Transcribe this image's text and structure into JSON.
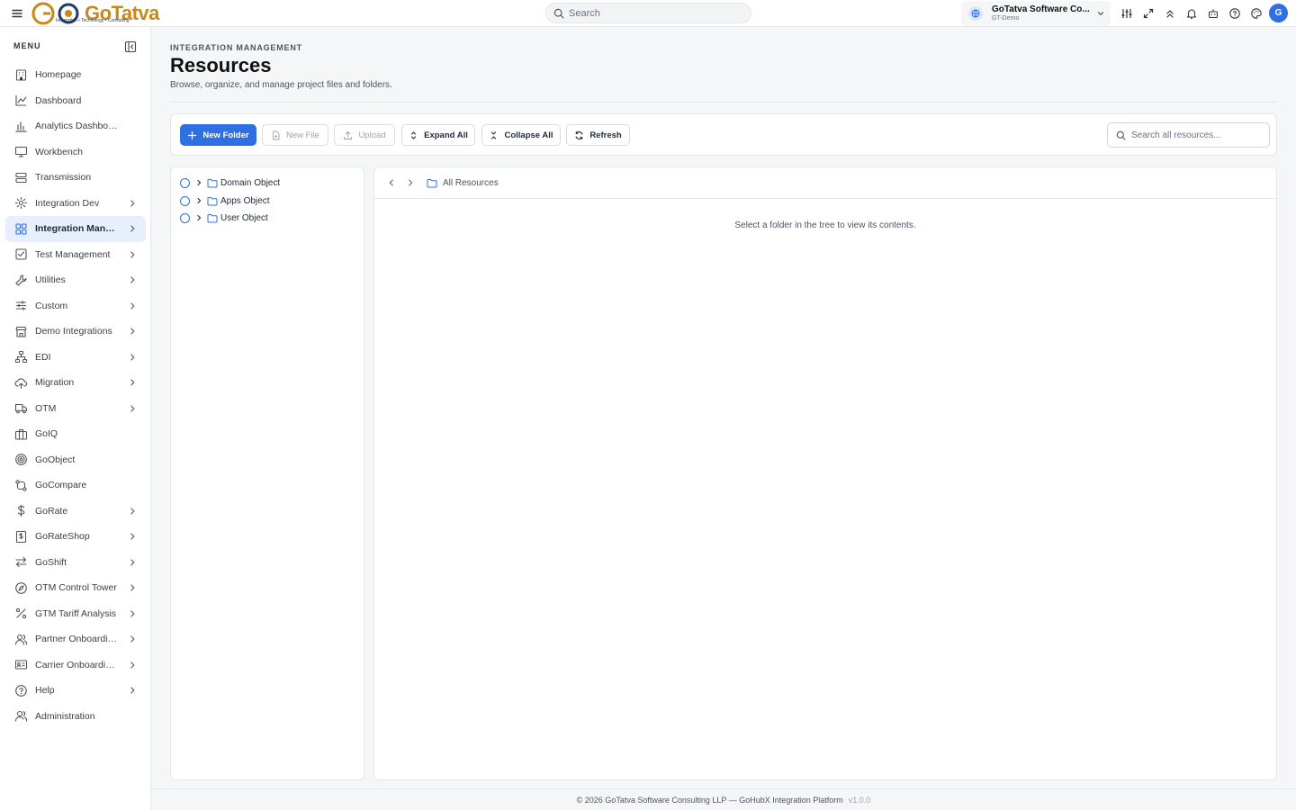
{
  "brand": {
    "logo_text": "GoTatva",
    "tagline": "Integration • Technology • Consulting"
  },
  "topbar": {
    "search_placeholder": "Search",
    "org_name": "GoTatva Software Co...",
    "org_env": "GT-Demo",
    "avatar_initial": "G",
    "icons": [
      "sliders-icon",
      "expand-icon",
      "chevrons-up-icon",
      "bell-icon",
      "bot-icon",
      "help-icon",
      "palette-icon"
    ]
  },
  "sidebar": {
    "menu_label": "MENU",
    "items": [
      {
        "label": "Homepage",
        "icon": "building-icon",
        "has_children": false
      },
      {
        "label": "Dashboard",
        "icon": "line-chart-icon",
        "has_children": false
      },
      {
        "label": "Analytics Dashboard",
        "icon": "bar-chart-icon",
        "has_children": false
      },
      {
        "label": "Workbench",
        "icon": "monitor-icon",
        "has_children": false
      },
      {
        "label": "Transmission",
        "icon": "server-icon",
        "has_children": false
      },
      {
        "label": "Integration Dev",
        "icon": "gear-icon",
        "has_children": true
      },
      {
        "label": "Integration Mana...",
        "icon": "grid-icon",
        "has_children": true,
        "active": true
      },
      {
        "label": "Test Management",
        "icon": "checkbox-icon",
        "has_children": true
      },
      {
        "label": "Utilities",
        "icon": "wrench-icon",
        "has_children": true
      },
      {
        "label": "Custom",
        "icon": "sliders-h-icon",
        "has_children": true
      },
      {
        "label": "Demo Integrations",
        "icon": "store-icon",
        "has_children": true
      },
      {
        "label": "EDI",
        "icon": "network-icon",
        "has_children": true
      },
      {
        "label": "Migration",
        "icon": "cloud-upload-icon",
        "has_children": true
      },
      {
        "label": "OTM",
        "icon": "truck-icon",
        "has_children": true
      },
      {
        "label": "GoIQ",
        "icon": "briefcase-icon",
        "has_children": false
      },
      {
        "label": "GoObject",
        "icon": "target-icon",
        "has_children": false
      },
      {
        "label": "GoCompare",
        "icon": "git-compare-icon",
        "has_children": false
      },
      {
        "label": "GoRate",
        "icon": "dollar-icon",
        "has_children": true
      },
      {
        "label": "GoRateShop",
        "icon": "receipt-icon",
        "has_children": true
      },
      {
        "label": "GoShift",
        "icon": "arrows-swap-icon",
        "has_children": true
      },
      {
        "label": "OTM Control Tower",
        "icon": "compass-icon",
        "has_children": true
      },
      {
        "label": "GTM Tariff Analysis",
        "icon": "percent-icon",
        "has_children": true
      },
      {
        "label": "Partner Onboarding",
        "icon": "users-icon",
        "has_children": true
      },
      {
        "label": "Carrier Onboardin...",
        "icon": "id-card-icon",
        "has_children": true
      },
      {
        "label": "Help",
        "icon": "help-circle-icon",
        "has_children": true
      },
      {
        "label": "Administration",
        "icon": "user-cog-icon",
        "has_children": false
      }
    ]
  },
  "page": {
    "eyebrow": "INTEGRATION MANAGEMENT",
    "title": "Resources",
    "subtitle": "Browse, organize, and manage project files and folders."
  },
  "toolbar": {
    "new_folder": "New Folder",
    "new_file": "New File",
    "upload": "Upload",
    "expand_all": "Expand All",
    "collapse_all": "Collapse All",
    "refresh": "Refresh",
    "search_placeholder": "Search all resources..."
  },
  "tree": {
    "items": [
      {
        "label": "Domain Object"
      },
      {
        "label": "Apps Object"
      },
      {
        "label": "User Object"
      }
    ]
  },
  "content": {
    "breadcrumb": "All Resources",
    "empty_message": "Select a folder in the tree to view its contents."
  },
  "footer": {
    "text": "© 2026 GoTatva Software Consulting LLP — GoHubX Integration Platform",
    "version": "v1.0.0"
  },
  "colors": {
    "accent": "#2f6fe4",
    "brand_gold": "#c58a1b",
    "active_bg": "#e8effc"
  }
}
